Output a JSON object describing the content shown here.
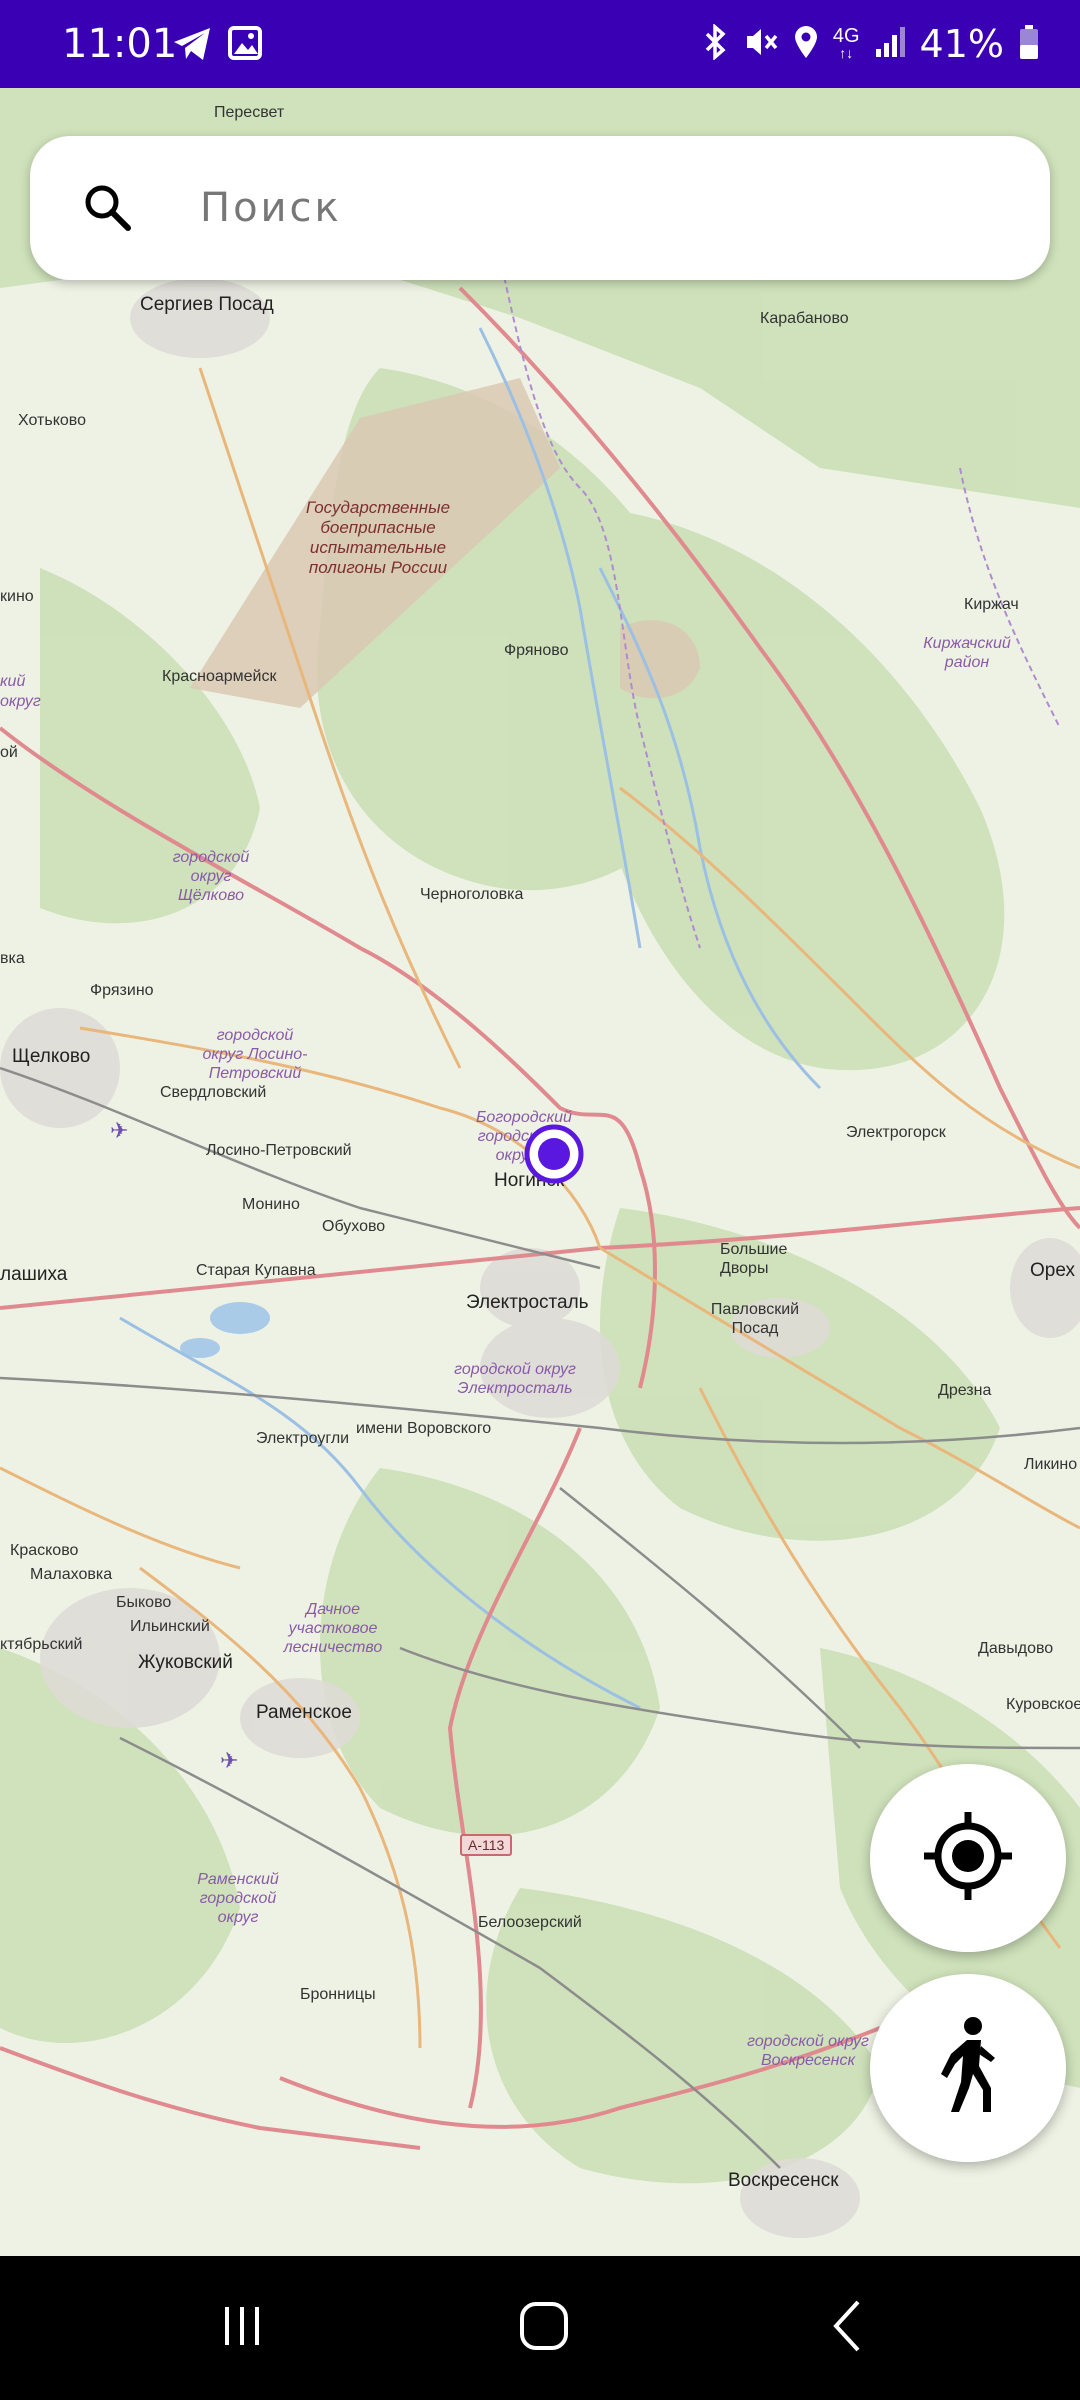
{
  "status_bar": {
    "time": "11:01",
    "left_icons": [
      "telegram-icon",
      "gallery-icon"
    ],
    "right_icons": [
      "bluetooth-icon",
      "vibrate-icon",
      "location-icon",
      "network-4g-icon",
      "signal-icon"
    ],
    "network_label": "4G",
    "battery_text": "41%",
    "background_color": "#3a00b4"
  },
  "search": {
    "placeholder": "Поиск"
  },
  "map": {
    "labels": {
      "peresvet": "Пересвет",
      "sergiev_posad": "Сергиев Посад",
      "karabanovo": "Карабаново",
      "khotkovo": "Хотьково",
      "polygon": "Государственные боеприпасные испытательные полигоны России",
      "krasnoarmeysk": "Красноармейск",
      "fryanovo": "Фряново",
      "kirzhach": "Киржач",
      "kirzhach_rayon": "Киржачский район",
      "shchelkovo_okrug": "городской округ Щёлково",
      "chernogolovka": "Черноголовка",
      "fryazino": "Фрязино",
      "losino_okrug": "городской округ Лосино-Петровский",
      "shchelkovo": "Щелково",
      "sverdlovsky": "Свердловский",
      "losino_petrovsky": "Лосино-Петровский",
      "bogorodsky_okrug": "Богородский городской округ",
      "noginsk": "Ногинск",
      "elektrogorsk": "Электрогорск",
      "monino": "Монино",
      "obukhovo": "Обухово",
      "balashikha": "лашиха",
      "staraya_kupavna": "Старая Купавна",
      "bolshie_dvory": "Большие Дворы",
      "orekhovo": "Орех",
      "elektrostal": "Электросталь",
      "pavlovsky_posad": "Павловский Посад",
      "elektrostal_okrug": "городской округ Электросталь",
      "drezna": "Дрезна",
      "elektrougli": "Электроугли",
      "vorovskogo": "имени Воровского",
      "likino": "Ликино",
      "kraskovo": "Красково",
      "malakhovka": "Малаховка",
      "bykovo": "Быково",
      "ilyinsky": "Ильинский",
      "oktyabrsky": "ктябрьский",
      "dachnoe": "Дачное участковое лесничество",
      "davydovo": "Давыдово",
      "zhukovsky": "Жуковский",
      "kurovskoe": "Куровское",
      "ramenskoe": "Раменское",
      "road_a113": "А-113",
      "ramensky_okrug": "Раменский городской округ",
      "beloozersky": "Белоозерский",
      "voskresensk_okrug": "городской округ Воскресенск",
      "bronnitsy": "Бронницы",
      "voskresensk": "Воскресенск",
      "edge_kino": "кино",
      "edge_kiy": "кий",
      "edge_okrug": "округ",
      "edge_oy": "ой",
      "edge_vka": "вка"
    }
  },
  "controls": {
    "locate_icon": "crosshair-icon",
    "walk_icon": "walking-person-icon",
    "accent_color": "#5a17e0"
  },
  "nav_bar": {
    "buttons": [
      "recents-icon",
      "home-icon",
      "back-icon"
    ]
  }
}
